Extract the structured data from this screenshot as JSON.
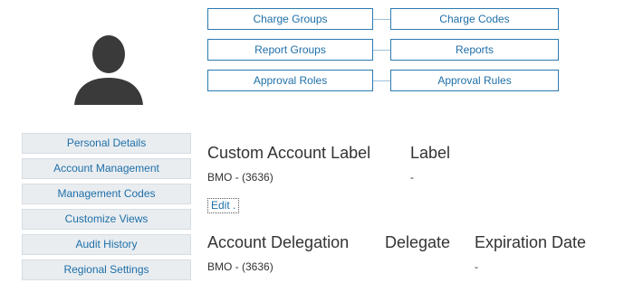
{
  "nav": {
    "charge_groups": "Charge Groups",
    "charge_codes": "Charge Codes",
    "report_groups": "Report Groups",
    "reports": "Reports",
    "approval_roles": "Approval Roles",
    "approval_rules": "Approval Rules"
  },
  "sidebar": {
    "items": [
      {
        "label": "Personal Details"
      },
      {
        "label": "Account Management"
      },
      {
        "label": "Management Codes"
      },
      {
        "label": "Customize Views"
      },
      {
        "label": "Audit History"
      },
      {
        "label": "Regional Settings"
      }
    ]
  },
  "custom_label": {
    "title": "Custom Account Label",
    "col_label": "Label",
    "account": "BMO - (3636)",
    "value": "-",
    "edit": "Edit ."
  },
  "delegation": {
    "title": "Account Delegation",
    "col_delegate": "Delegate",
    "col_expiration": "Expiration Date",
    "account": "BMO - (3636)",
    "expiration": "-"
  },
  "colors": {
    "accent": "#1f6fa8",
    "border": "#2a7ab0",
    "sidebar_bg": "#e9edf0",
    "avatar": "#3a3a3a"
  },
  "icons": {
    "avatar": "user-silhouette-icon"
  }
}
